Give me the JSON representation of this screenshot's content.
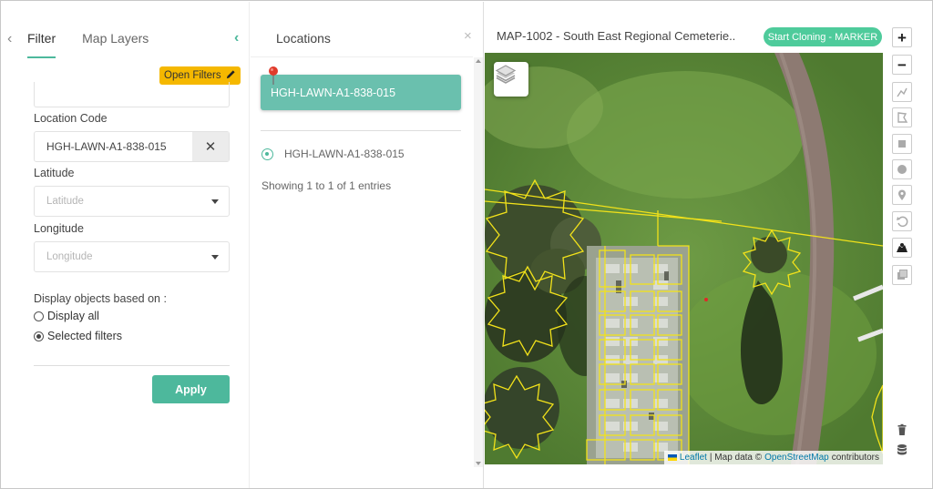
{
  "filter_panel": {
    "tabs": [
      {
        "label": "Filter",
        "active": true
      },
      {
        "label": "Map Layers",
        "active": false
      }
    ],
    "open_filters_label": "Open Filters",
    "location_code": {
      "label": "Location Code",
      "value": "HGH-LAWN-A1-838-015"
    },
    "latitude": {
      "label": "Latitude",
      "placeholder": "Latitude"
    },
    "longitude": {
      "label": "Longitude",
      "placeholder": "Longitude"
    },
    "display_heading": "Display objects based on :",
    "display_options": [
      {
        "label": "Display all",
        "selected": false
      },
      {
        "label": "Selected filters",
        "selected": true
      }
    ],
    "apply_label": "Apply"
  },
  "locations_panel": {
    "title": "Locations",
    "close_glyph": "×",
    "selected_item": "HGH-LAWN-A1-838-015",
    "items": [
      {
        "label": "HGH-LAWN-A1-838-015"
      }
    ],
    "showing_text": "Showing 1 to 1 of 1 entries"
  },
  "map": {
    "title": "MAP-1002 - South East Regional Cemeterie..",
    "clone_button_label": "Start Cloning - MARKER",
    "attribution": {
      "leaflet": "Leaflet",
      "separator": "| Map data ©",
      "osm": "OpenStreetMap",
      "contributors": "contributors"
    }
  },
  "toolbar": {
    "zoom_in": "+",
    "zoom_out": "−",
    "icons": [
      "polyline-icon",
      "polygon-icon",
      "rectangle-icon",
      "circle-icon",
      "marker-icon",
      "undo-icon",
      "map-layers-icon",
      "copy-icon",
      "trash-icon",
      "database-icon"
    ]
  },
  "colors": {
    "accent": "#4db89c",
    "selected_card": "#6ac0ae",
    "open_filters": "#f5b800",
    "clone_button": "#4ecb9b",
    "map_outline": "#f2e21a"
  }
}
